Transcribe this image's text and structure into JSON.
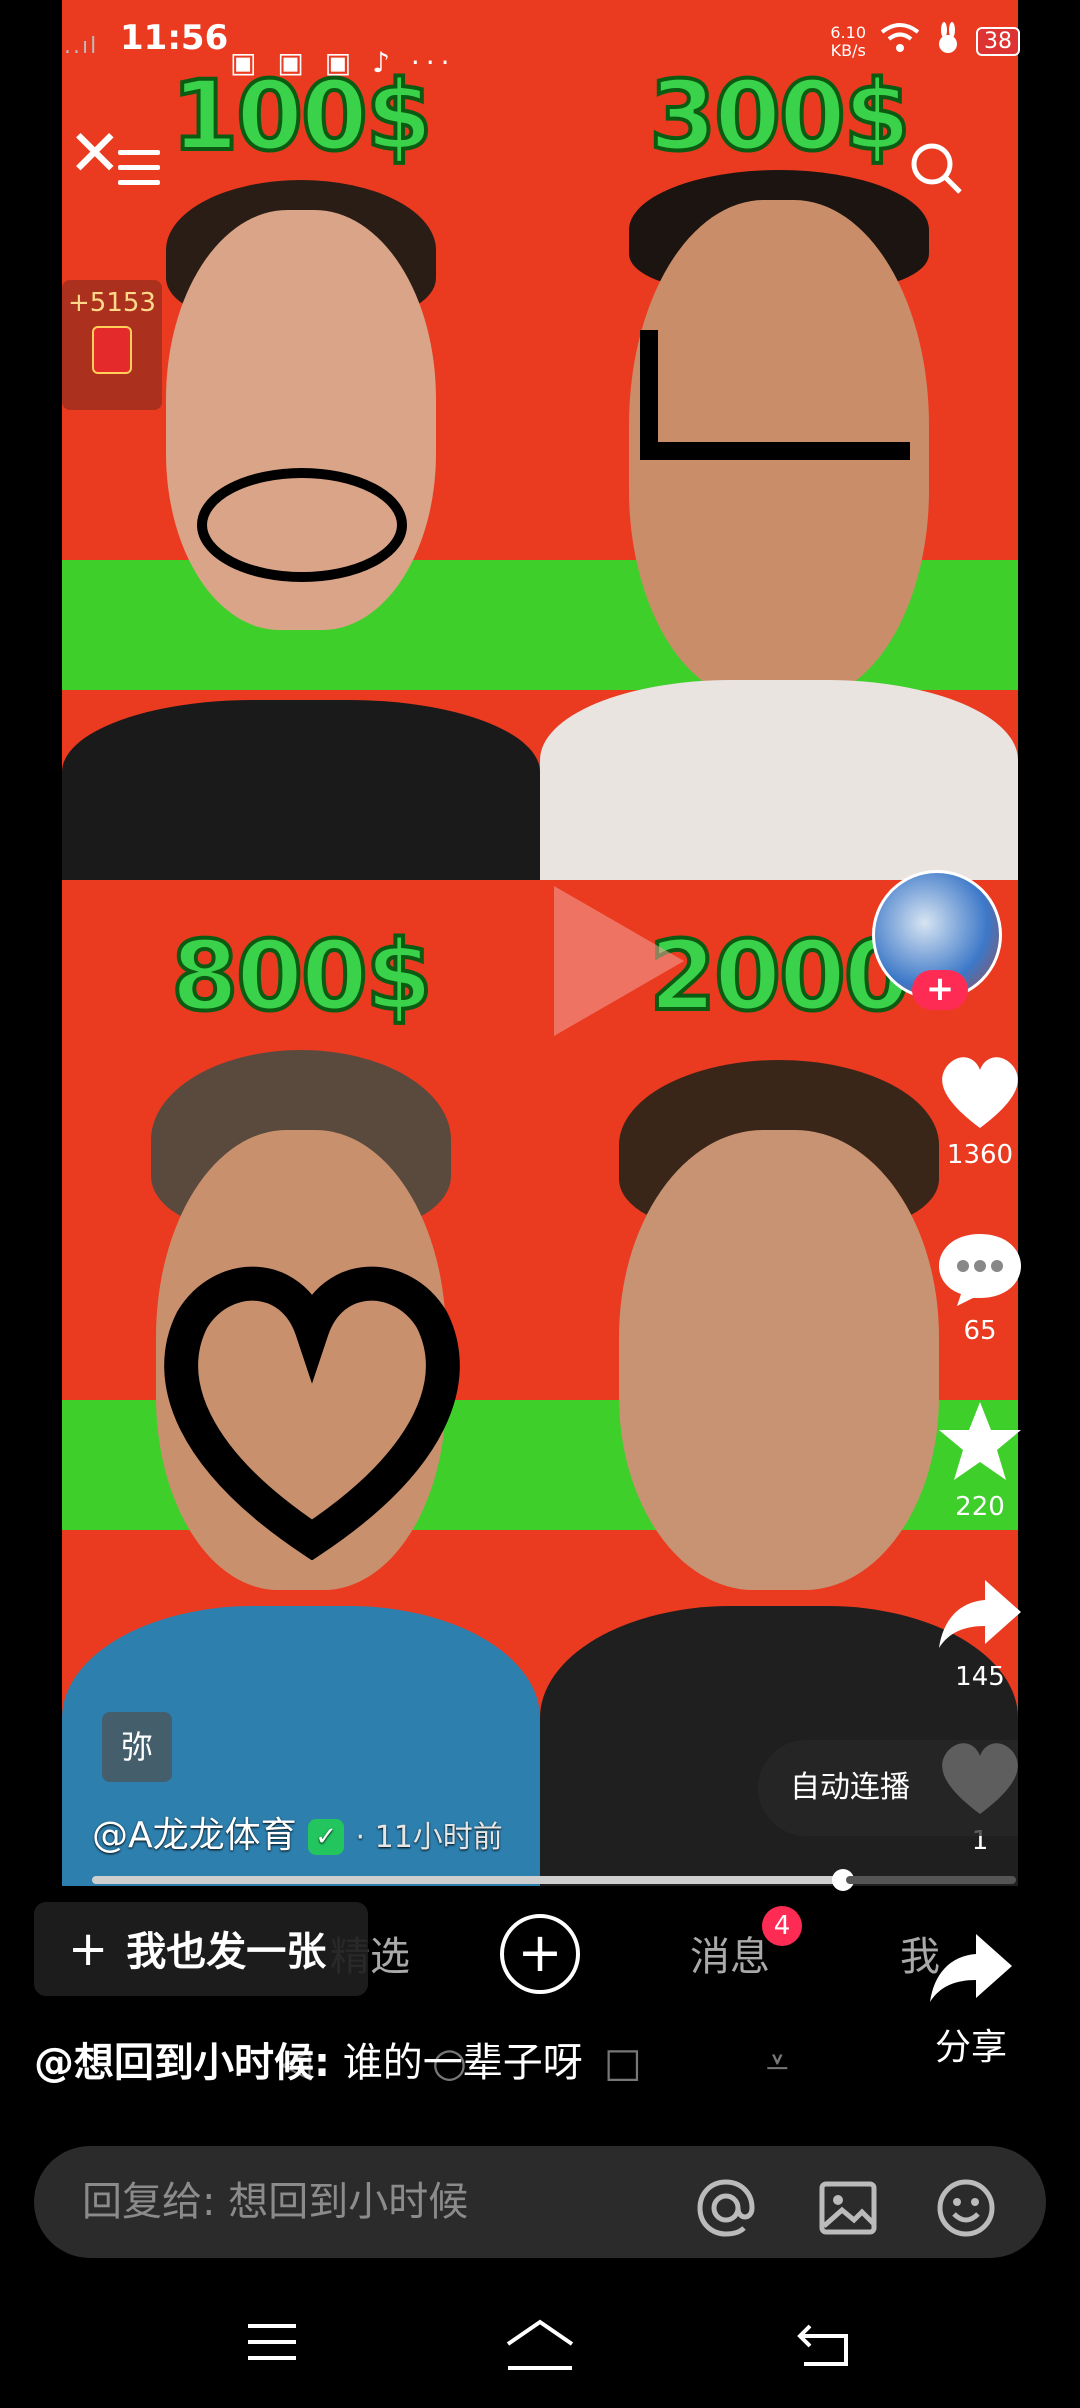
{
  "status_bar": {
    "time": "11:56",
    "signal_left": "..ıl",
    "net_speed": "6.10",
    "net_unit": "KB/s",
    "battery": "38",
    "app_icons": "▣ ▣ ▣ ♪ ···"
  },
  "video": {
    "prices": [
      "100$",
      "300$",
      "800$",
      "2000"
    ],
    "author": "@A龙龙体育",
    "time_ago": "· 11小时前",
    "watermark_label": "弥",
    "autoplay_label": "自动连播",
    "red_packet_points": "+5153",
    "colors": {
      "background": "#e8321f",
      "green": "#3ecf2a",
      "price": "#3ad24a"
    }
  },
  "rail": {
    "likes": "1360",
    "comments": "65",
    "favorites": "220",
    "shares": "145",
    "extra_like": "1"
  },
  "tabs": {
    "featured": "精选",
    "messages": "消息",
    "messages_badge": "4",
    "me": "我"
  },
  "overlay": {
    "make_button": "我也发一张",
    "make_plus": "+",
    "share_label": "分享"
  },
  "comment": {
    "user": "@想回到小时候:",
    "text": " 谁的一辈子呀"
  },
  "reply": {
    "placeholder": "回复给: 想回到小时候"
  }
}
